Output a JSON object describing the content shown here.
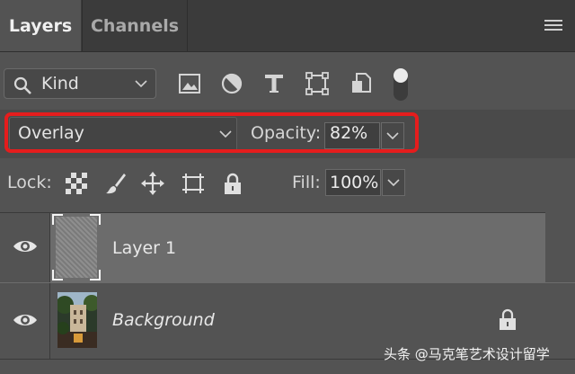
{
  "tabs": [
    {
      "label": "Layers",
      "active": true
    },
    {
      "label": "Channels",
      "active": false
    }
  ],
  "filter": {
    "kind_label": "Kind",
    "icons": [
      "image-filter-icon",
      "adjustment-filter-icon",
      "type-filter-icon",
      "shape-filter-icon",
      "smart-object-filter-icon",
      "filter-toggle"
    ]
  },
  "blend": {
    "mode": "Overlay",
    "opacity_label": "Opacity:",
    "opacity_value": "82%"
  },
  "lock": {
    "label": "Lock:",
    "icons": [
      "lock-transparent-pixels-icon",
      "lock-image-pixels-icon",
      "lock-position-icon",
      "lock-artboard-icon",
      "lock-all-icon"
    ],
    "fill_label": "Fill:",
    "fill_value": "100%"
  },
  "layers": [
    {
      "name": "Layer 1",
      "selected": true,
      "visible": true
    },
    {
      "name": "Background",
      "selected": false,
      "visible": true,
      "locked": true
    }
  ],
  "watermark": "头条 @马克笔艺术设计留学",
  "colors": {
    "highlight": "#e51d1d",
    "panel": "#535353",
    "selected_layer": "#6c6c6c"
  }
}
